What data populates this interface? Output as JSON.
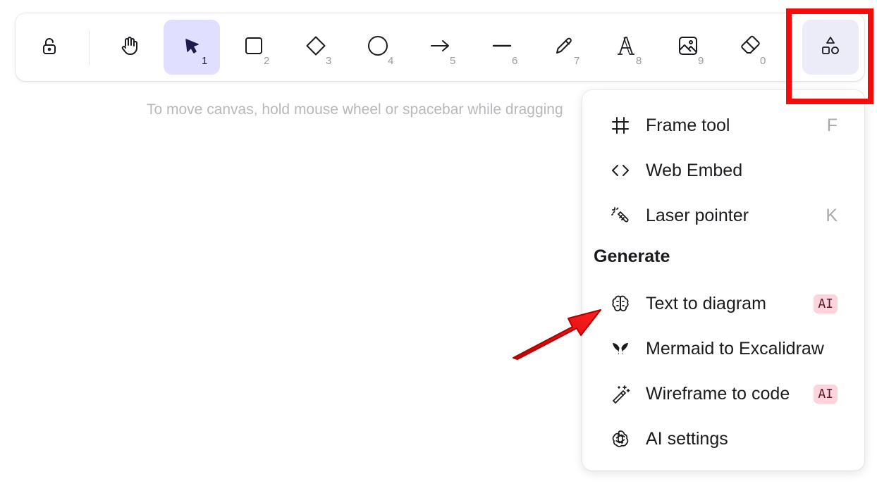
{
  "toolbar": {
    "tools": [
      {
        "name": "lock",
        "key": ""
      },
      {
        "name": "hand",
        "key": ""
      },
      {
        "name": "selection",
        "key": "1"
      },
      {
        "name": "rectangle",
        "key": "2"
      },
      {
        "name": "diamond",
        "key": "3"
      },
      {
        "name": "ellipse",
        "key": "4"
      },
      {
        "name": "arrow",
        "key": "5"
      },
      {
        "name": "line",
        "key": "6"
      },
      {
        "name": "draw",
        "key": "7"
      },
      {
        "name": "text",
        "key": "8"
      },
      {
        "name": "image",
        "key": "9"
      },
      {
        "name": "eraser",
        "key": "0"
      },
      {
        "name": "more-tools",
        "key": ""
      }
    ],
    "selected_tool": "selection"
  },
  "hint": "To move canvas, hold mouse wheel or spacebar while dragging",
  "menu": {
    "items": [
      {
        "label": "Frame tool",
        "shortcut": "F",
        "icon": "frame-icon"
      },
      {
        "label": "Web Embed",
        "shortcut": "",
        "icon": "code-brackets-icon"
      },
      {
        "label": "Laser pointer",
        "shortcut": "K",
        "icon": "laser-pointer-icon"
      }
    ],
    "section_title": "Generate",
    "generate_items": [
      {
        "label": "Text to diagram",
        "badge": "AI",
        "icon": "brain-icon"
      },
      {
        "label": "Mermaid to Excalidraw",
        "badge": "",
        "icon": "mermaid-icon"
      },
      {
        "label": "Wireframe to code",
        "badge": "AI",
        "icon": "magic-wand-icon"
      },
      {
        "label": "AI settings",
        "badge": "",
        "icon": "openai-icon"
      }
    ]
  },
  "colors": {
    "selected_bg": "#e0dfff",
    "highlight_red": "#f20c0c",
    "badge_bg": "#fdd3dc"
  }
}
